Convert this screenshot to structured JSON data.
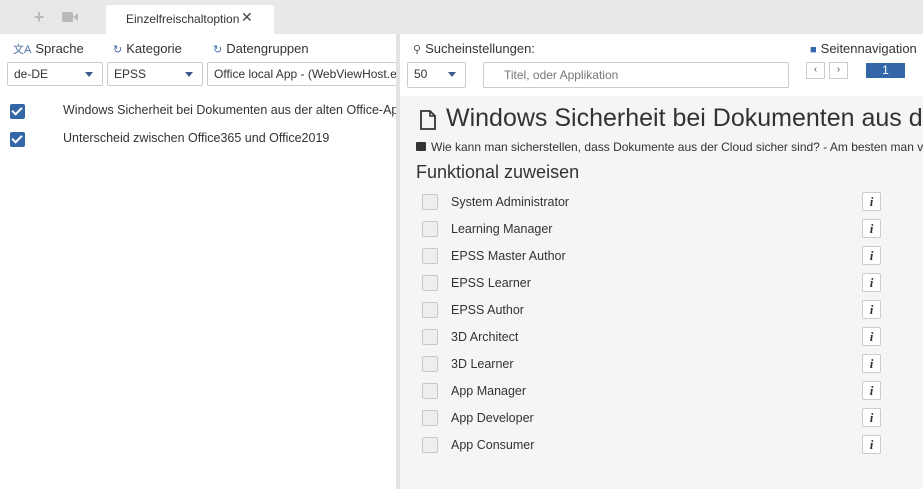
{
  "tabbar": {
    "add_icon": "plus-icon",
    "camera_icon": "video-camera-icon",
    "active_tab_label": "Einzelfreischaltoption",
    "close_icon": "close-icon"
  },
  "filters": {
    "language": {
      "label": "Sprache",
      "icon": "translate-icon",
      "value": "de-DE"
    },
    "category": {
      "label": "Kategorie",
      "icon": "refresh-icon",
      "value": "EPSS"
    },
    "datagroups": {
      "label": "Datengruppen",
      "icon": "refresh-icon",
      "value": "Office local App - (WebViewHost.e"
    }
  },
  "left_list": [
    {
      "label": "Windows Sicherheit bei Dokumenten aus der alten Office-App",
      "checked": true
    },
    {
      "label": "Unterscheid zwischen Office365 und Office2019",
      "checked": true
    }
  ],
  "search": {
    "label": "Sucheinstellungen:",
    "icon": "search-icon",
    "page_size": "50",
    "placeholder": "Titel, oder Applikation"
  },
  "pagination": {
    "label": "Seitennavigation",
    "icon": "book-icon",
    "prev": "‹",
    "next": "›",
    "current_page": "1"
  },
  "detail": {
    "title": "Windows Sicherheit bei Dokumenten aus der alten Office-App",
    "description": "Wie kann man sicherstellen, dass Dokumente aus der Cloud sicher sind? - Am besten man verwendet die neue Office-App",
    "section_heading": "Funktional zuweisen",
    "roles": [
      {
        "label": "System Administrator",
        "checked": false
      },
      {
        "label": "Learning Manager",
        "checked": false
      },
      {
        "label": "EPSS Master Author",
        "checked": false
      },
      {
        "label": "EPSS Learner",
        "checked": false
      },
      {
        "label": "EPSS Author",
        "checked": false
      },
      {
        "label": "3D Architect",
        "checked": false
      },
      {
        "label": "3D Learner",
        "checked": false
      },
      {
        "label": "App Manager",
        "checked": false
      },
      {
        "label": "App Developer",
        "checked": false
      },
      {
        "label": "App Consumer",
        "checked": false
      }
    ],
    "info_button_label": "i"
  },
  "colors": {
    "accent": "#3466a8",
    "body_bg": "#f5f5f5",
    "tabbar_bg": "#e8e8e8"
  }
}
